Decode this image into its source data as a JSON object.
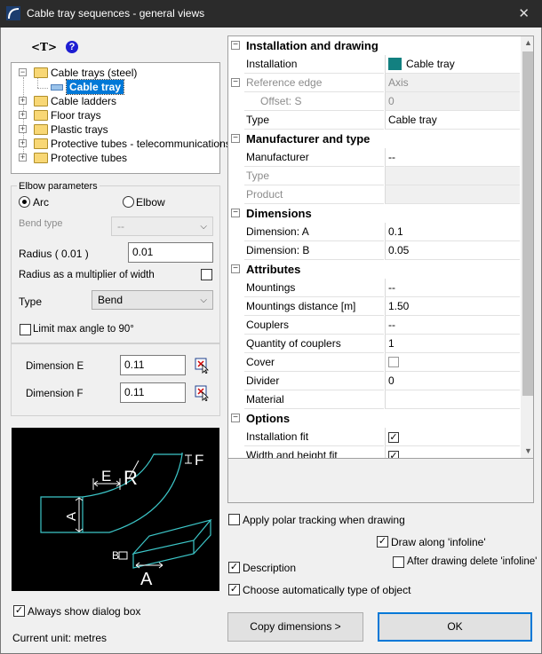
{
  "window": {
    "title": "Cable tray sequences - general views",
    "close": "✕"
  },
  "toolbar": {
    "text_tool": "<T>",
    "help": "?"
  },
  "tree": {
    "items": [
      {
        "label": "Cable trays (steel)",
        "expander": "−"
      },
      {
        "label": "Cable tray",
        "selected": true
      },
      {
        "label": "Cable ladders",
        "expander": "+"
      },
      {
        "label": "Floor trays",
        "expander": "+"
      },
      {
        "label": "Plastic trays",
        "expander": "+"
      },
      {
        "label": "Protective tubes - telecommunications",
        "expander": "+"
      },
      {
        "label": "Protective tubes",
        "expander": "+"
      }
    ]
  },
  "elbow": {
    "group_label": "Elbow parameters",
    "arc_label": "Arc",
    "elbow_label": "Elbow",
    "arc_selected": true,
    "bend_type_label": "Bend type",
    "bend_type_value": "--",
    "radius_label": "Radius ( 0.01 )",
    "radius_value": "0.01",
    "radius_multiplier_label": "Radius as a multiplier of width",
    "radius_multiplier_checked": false,
    "type_label": "Type",
    "type_value": "Bend",
    "limit_label": "Limit max angle to 90°",
    "limit_checked": false
  },
  "dimensions": {
    "e_label": "Dimension E",
    "e_value": "0.11",
    "f_label": "Dimension F",
    "f_value": "0.11"
  },
  "preview": {
    "label_e": "E",
    "label_r": "R",
    "label_f": "F",
    "label_a": "A",
    "label_b": "B",
    "label_a2": "A"
  },
  "always_show": {
    "label": "Always show dialog box",
    "checked": true
  },
  "current_unit": "Current unit: metres",
  "properties": [
    {
      "category": "Installation and drawing",
      "expander": "−"
    },
    {
      "name": "Installation",
      "value": "Cable tray",
      "swatch": "#128080"
    },
    {
      "name": "Reference edge",
      "value": "Axis",
      "disabled": true,
      "expander": "−"
    },
    {
      "name": "Offset: S",
      "value": "0",
      "disabled": true,
      "indent": true
    },
    {
      "name": "Type",
      "value": "Cable tray"
    },
    {
      "category": "Manufacturer and type",
      "expander": "−"
    },
    {
      "name": "Manufacturer",
      "value": "--"
    },
    {
      "name": "Type",
      "value": "",
      "disabled": true
    },
    {
      "name": "Product",
      "value": "",
      "disabled": true
    },
    {
      "category": "Dimensions",
      "expander": "−"
    },
    {
      "name": "Dimension: A",
      "value": "0.1"
    },
    {
      "name": "Dimension: B",
      "value": "0.05"
    },
    {
      "category": "Attributes",
      "expander": "−"
    },
    {
      "name": "Mountings",
      "value": "--"
    },
    {
      "name": "Mountings distance [m]",
      "value": "1.50"
    },
    {
      "name": "Couplers",
      "value": "--"
    },
    {
      "name": "Quantity of couplers",
      "value": "1"
    },
    {
      "name": "Cover",
      "value": "",
      "check": false
    },
    {
      "name": "Divider",
      "value": "0"
    },
    {
      "name": "Material",
      "value": ""
    },
    {
      "category": "Options",
      "expander": "−"
    },
    {
      "name": "Installation fit",
      "value": "",
      "check": true
    },
    {
      "name": "Width and height fit",
      "value": "",
      "check": true
    }
  ],
  "options": {
    "polar_label": "Apply polar tracking when drawing",
    "polar_checked": false,
    "infoline_label": "Draw along 'infoline'",
    "infoline_checked": true,
    "delete_infoline_label": "After drawing delete 'infoline'",
    "delete_infoline_checked": false,
    "description_label": "Description",
    "description_checked": true,
    "auto_type_label": "Choose automatically type of object",
    "auto_type_checked": true
  },
  "buttons": {
    "copy": "Copy dimensions >",
    "ok": "OK"
  },
  "colors": {
    "cad_lines": "#3cc6c8",
    "selection": "#0078d7",
    "swatch": "#128080"
  }
}
